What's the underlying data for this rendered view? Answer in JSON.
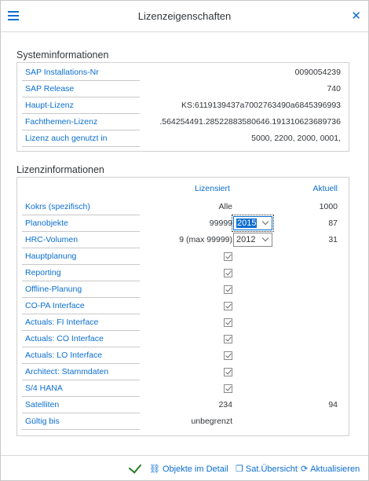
{
  "header": {
    "title": "Lizenzeigenschaften"
  },
  "system": {
    "title": "Systeminformationen",
    "rows": [
      {
        "label": "SAP Installations-Nr",
        "value": "0090054239"
      },
      {
        "label": "SAP Release",
        "value": "740"
      },
      {
        "label": "Haupt-Lizenz",
        "value": "KS:6119139437a7002763490a6845396993"
      },
      {
        "label": "Fachthemen-Lizenz",
        "value": ".564254491.28522883580646.191310623689736"
      },
      {
        "label": "Lizenz auch genutzt in",
        "value": "5000, 2200, 2000, 0001,"
      }
    ]
  },
  "license": {
    "title": "Lizenzinformationen",
    "col_licensed": "Lizensiert",
    "col_actual": "Aktuell",
    "kokrs": {
      "label": "Kokrs (spezifisch)",
      "licensed": "Alle",
      "actual": "1000"
    },
    "planobjekte": {
      "label": "Planobjekte",
      "licensed": "99999",
      "select": "2015",
      "actual": "87"
    },
    "hrc": {
      "label": "HRC-Volumen",
      "licensed": "9 (max 99999)",
      "select": "2012",
      "actual": "31"
    },
    "checks": [
      {
        "label": "Hauptplanung"
      },
      {
        "label": "Reporting"
      },
      {
        "label": "Offline-Planung"
      },
      {
        "label": "CO-PA Interface"
      },
      {
        "label": "Actuals: FI Interface"
      },
      {
        "label": "Actuals: CO Interface"
      },
      {
        "label": "Actuals: LO Interface"
      },
      {
        "label": "Architect: Stammdaten"
      },
      {
        "label": "S/4 HANA"
      }
    ],
    "satelliten": {
      "label": "Satelliten",
      "licensed": "234",
      "actual": "94"
    },
    "gueltig": {
      "label": "Gültig bis",
      "licensed": "unbegrenzt"
    }
  },
  "footer": {
    "objekte": "Objekte im Detail",
    "sat": "Sat.Übersicht",
    "aktualisieren": "Aktualisieren"
  }
}
